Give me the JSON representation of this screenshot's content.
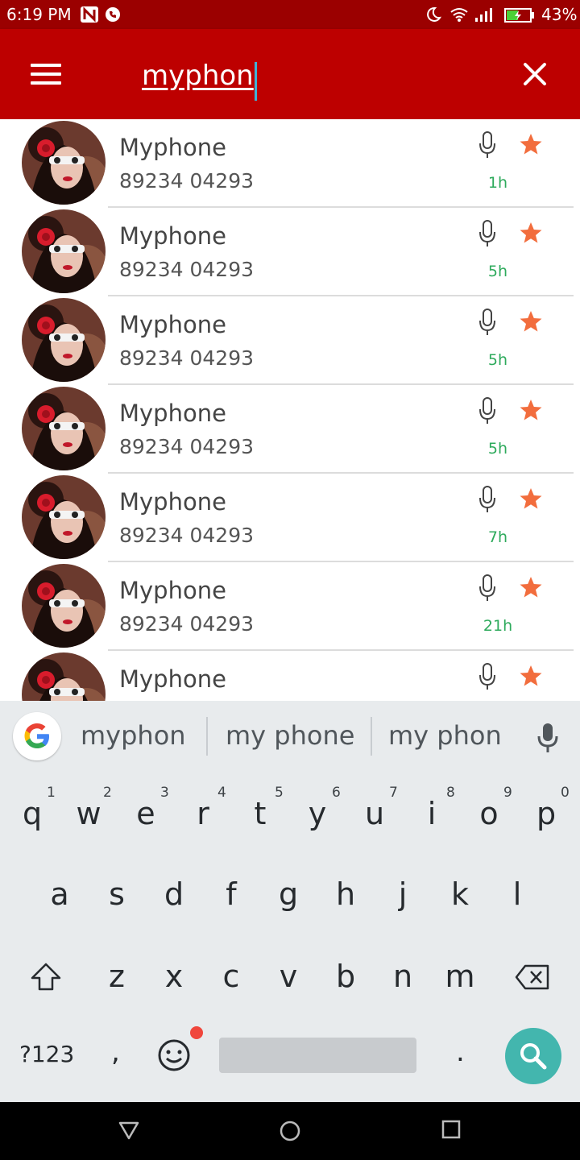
{
  "status_bar": {
    "time": "6:19 PM",
    "battery_percent": "43%",
    "icons": [
      "n-icon",
      "call-icon",
      "moon-icon",
      "wifi-icon",
      "signal-icon",
      "battery-icon"
    ]
  },
  "app_bar": {
    "search_value": "myphon",
    "accent_color": "#bd0000"
  },
  "contacts": [
    {
      "name": "Myphone",
      "phone": "89234 04293",
      "ago": "1h"
    },
    {
      "name": "Myphone",
      "phone": "89234 04293",
      "ago": "5h"
    },
    {
      "name": "Myphone",
      "phone": "89234 04293",
      "ago": "5h"
    },
    {
      "name": "Myphone",
      "phone": "89234 04293",
      "ago": "5h"
    },
    {
      "name": "Myphone",
      "phone": "89234 04293",
      "ago": "7h"
    },
    {
      "name": "Myphone",
      "phone": "89234 04293",
      "ago": "21h"
    },
    {
      "name": "Myphone"
    }
  ],
  "suggestions": [
    "myphon",
    "my phone",
    "my phon"
  ],
  "keyboard": {
    "row1": [
      "q",
      "w",
      "e",
      "r",
      "t",
      "y",
      "u",
      "i",
      "o",
      "p"
    ],
    "row1_hints": [
      "1",
      "2",
      "3",
      "4",
      "5",
      "6",
      "7",
      "8",
      "9",
      "0"
    ],
    "row2": [
      "a",
      "s",
      "d",
      "f",
      "g",
      "h",
      "j",
      "k",
      "l"
    ],
    "row3": [
      "z",
      "x",
      "c",
      "v",
      "b",
      "n",
      "m"
    ],
    "symbols_label": "?123",
    "comma": ",",
    "period": "."
  }
}
